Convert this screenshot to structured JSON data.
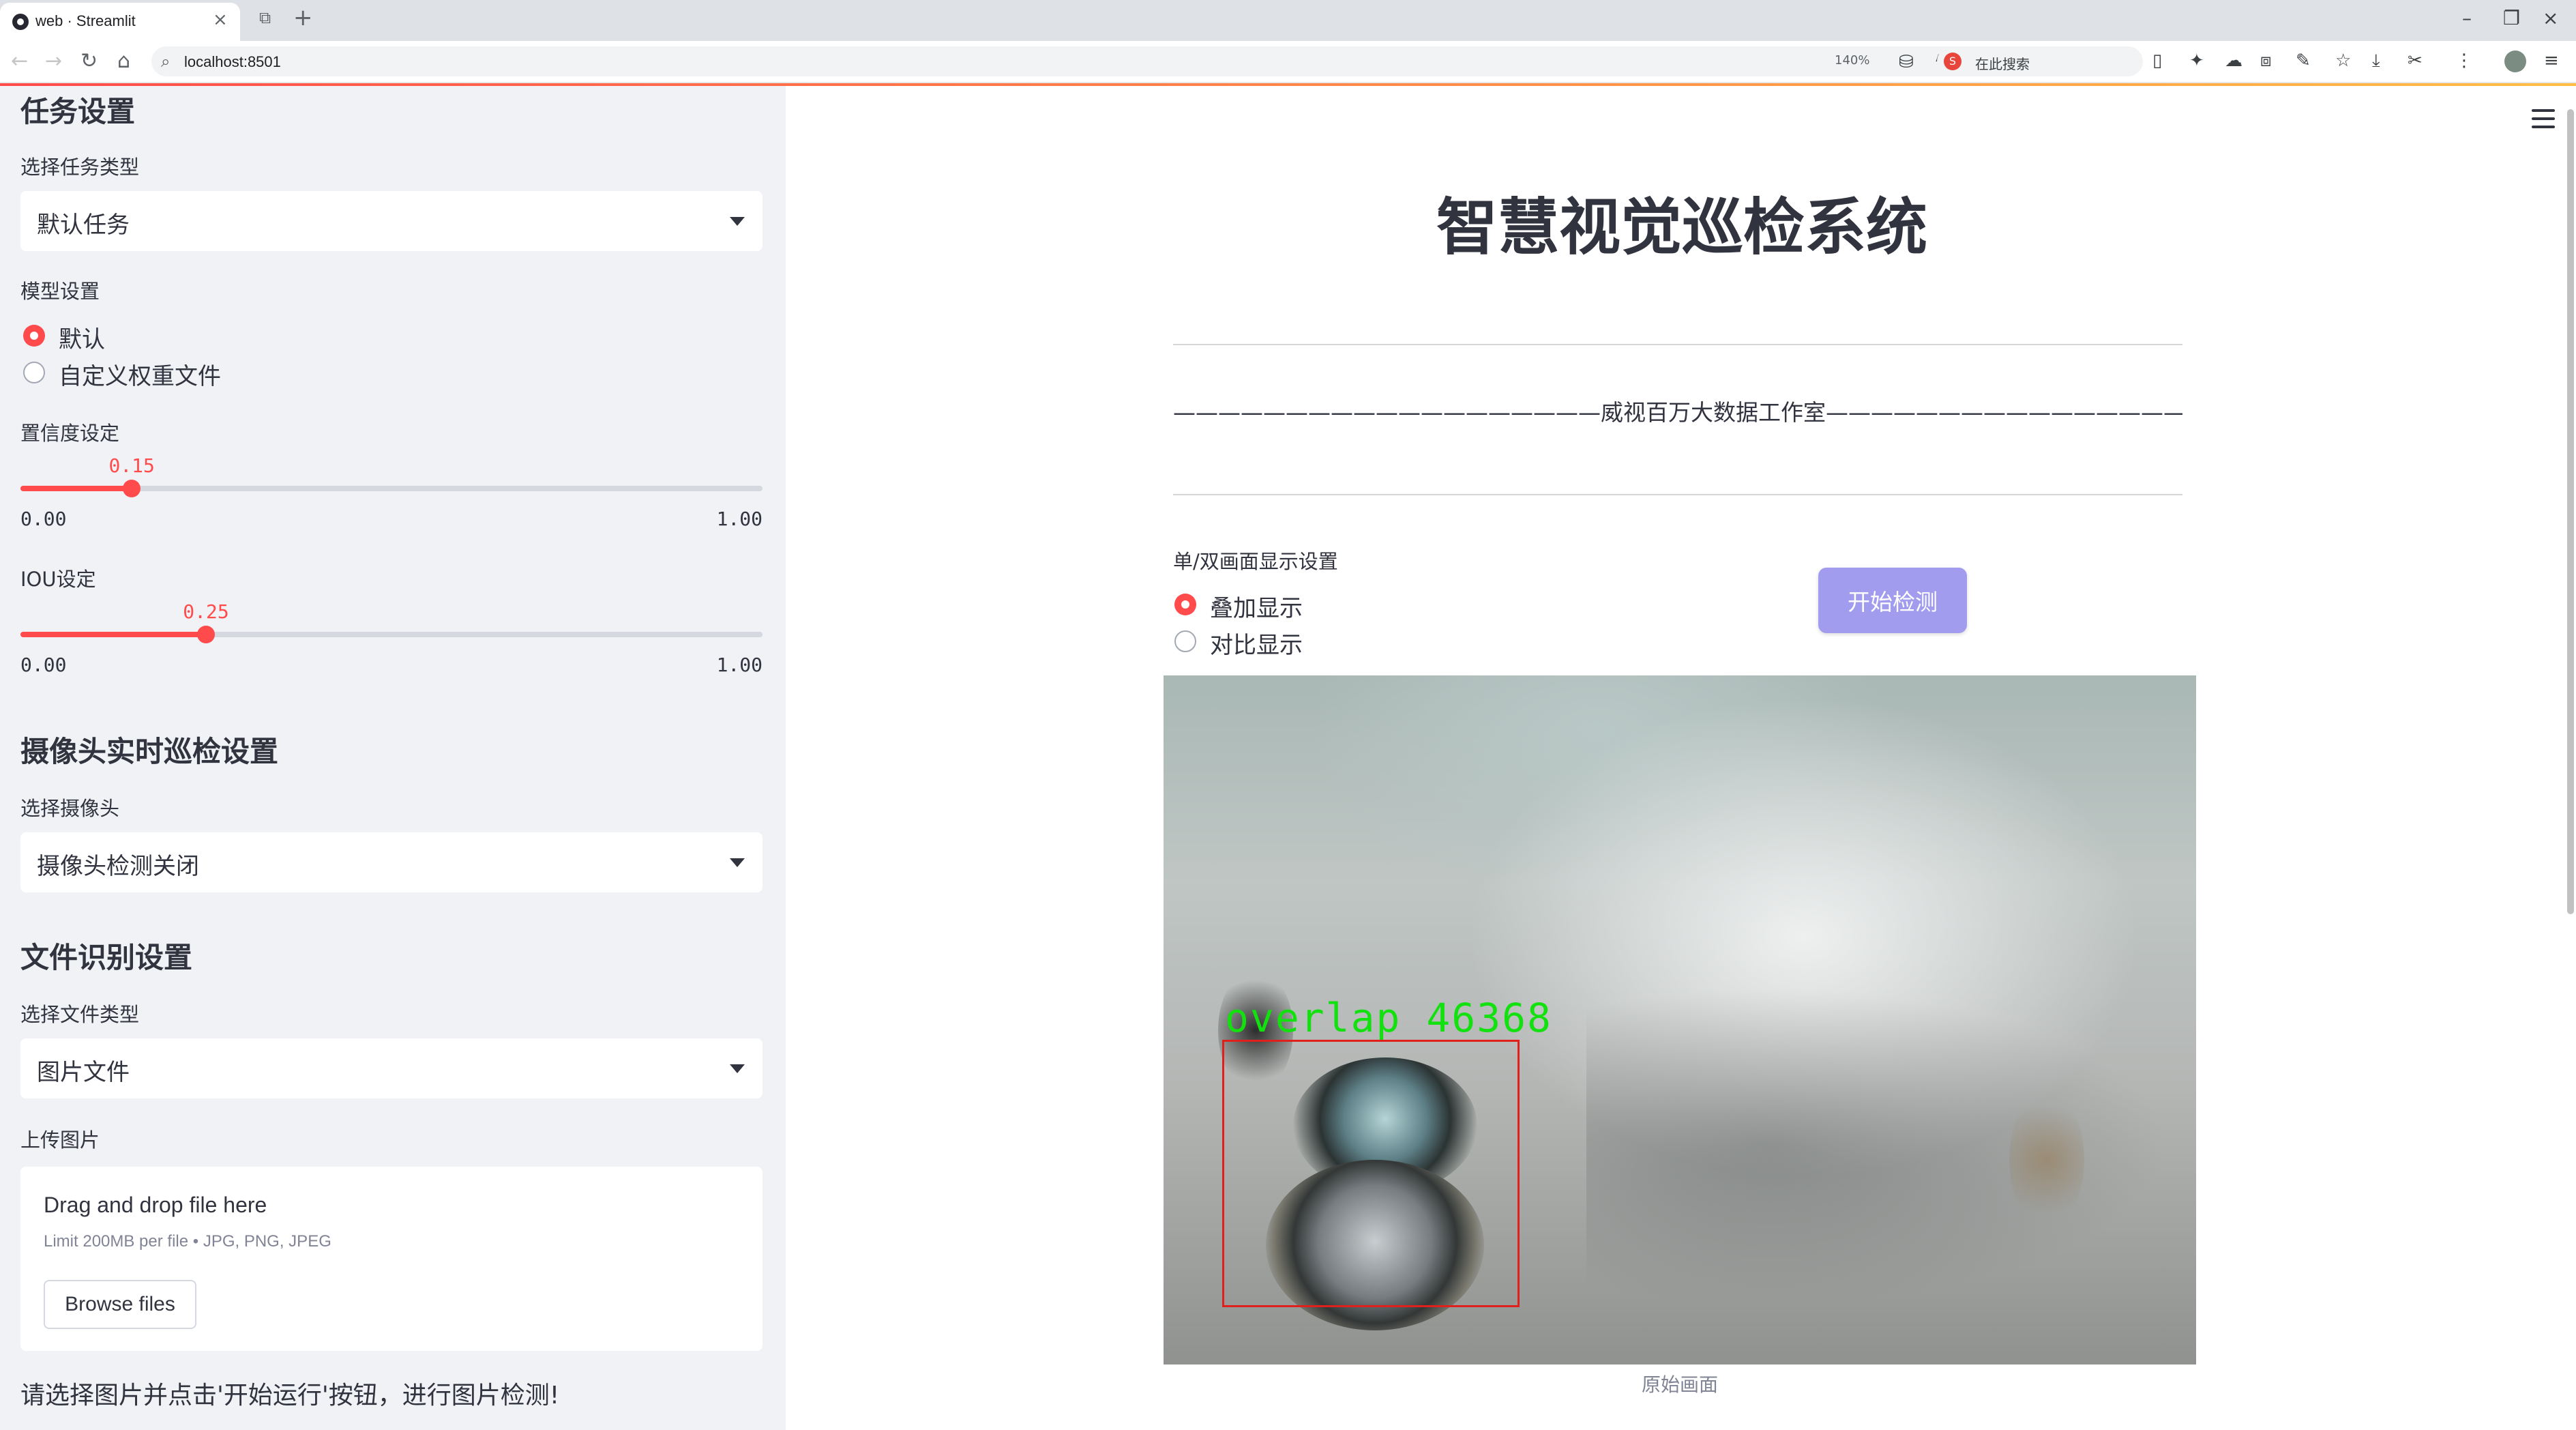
{
  "browser": {
    "tab_title": "web · Streamlit",
    "url": "localhost:8501",
    "zoom": "140%",
    "search_label": "在此搜索"
  },
  "sidebar": {
    "task_section": {
      "title": "任务设置",
      "label": "选择任务类型",
      "value": "默认任务"
    },
    "model": {
      "label": "模型设置",
      "options": [
        {
          "label": "默认",
          "selected": true
        },
        {
          "label": "自定义权重文件",
          "selected": false
        }
      ]
    },
    "confidence": {
      "label": "置信度设定",
      "value": 0.15,
      "value_text": "0.15",
      "min": "0.00",
      "max": "1.00"
    },
    "iou": {
      "label": "IOU设定",
      "value": 0.25,
      "value_text": "0.25",
      "min": "0.00",
      "max": "1.00"
    },
    "camera_section": {
      "title": "摄像头实时巡检设置",
      "label": "选择摄像头",
      "value": "摄像头检测关闭"
    },
    "file_section": {
      "title": "文件识别设置",
      "label": "选择文件类型",
      "value": "图片文件",
      "upload_label": "上传图片",
      "dropzone_title": "Drag and drop file here",
      "dropzone_limit": "Limit 200MB per file • JPG, PNG, JPEG",
      "browse_label": "Browse files"
    },
    "note": "请选择图片并点击'开始运行'按钮，进行图片检测!"
  },
  "main": {
    "title": "智慧视觉巡检系统",
    "subtitle": "———————————————————威视百万大数据工作室——————————————————————",
    "display_label": "单/双画面显示设置",
    "display_options": [
      {
        "label": "叠加显示",
        "selected": true
      },
      {
        "label": "对比显示",
        "selected": false
      }
    ],
    "start_button": "开始检测",
    "detection_label": "overlap  46368",
    "caption": "原始画面"
  },
  "colors": {
    "accent": "#ff4b4b",
    "start_button": "#a19ced",
    "sidebar_bg": "#f0f2f6",
    "detection_box": "#e0201c",
    "detection_text": "#12e10f"
  }
}
